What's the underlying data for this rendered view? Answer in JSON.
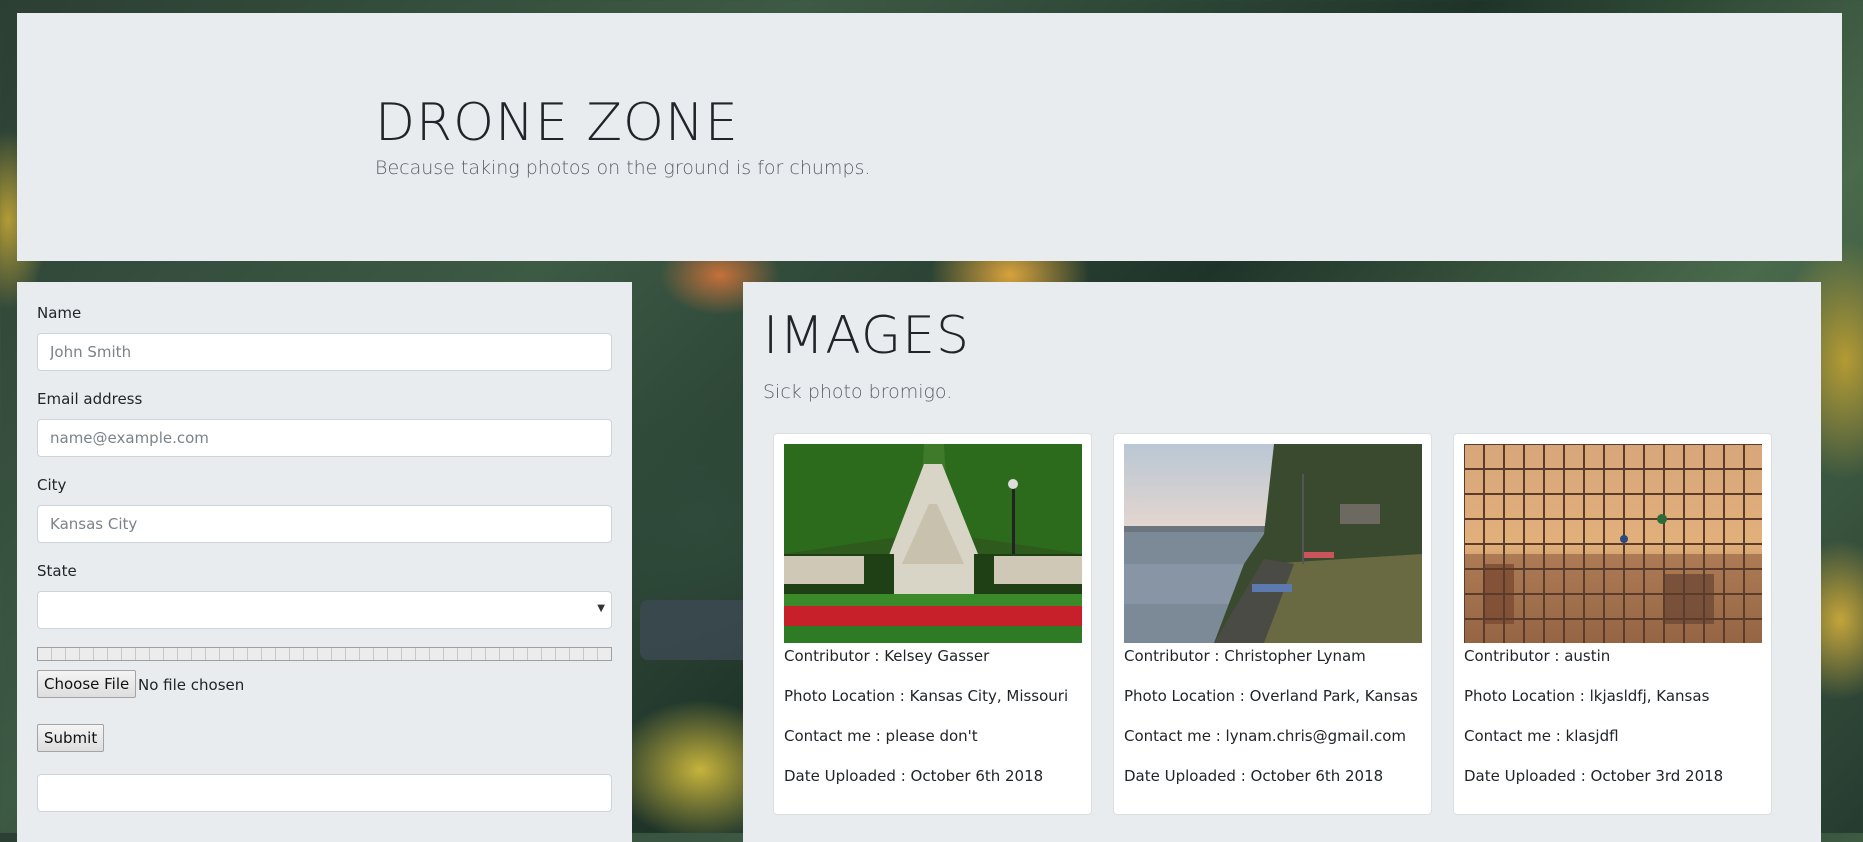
{
  "header": {
    "title": "DRONE ZONE",
    "tagline": "Because taking photos on the ground is for chumps."
  },
  "form": {
    "name_label": "Name",
    "name_placeholder": "John Smith",
    "email_label": "Email address",
    "email_placeholder": "name@example.com",
    "city_label": "City",
    "city_placeholder": "Kansas City",
    "state_label": "State",
    "state_value": "",
    "upload_progress": 0,
    "choose_file_label": "Choose File",
    "no_file_text": "No file chosen",
    "submit_label": "Submit"
  },
  "gallery": {
    "title": "IMAGES",
    "subtitle": "Sick photo bromigo.",
    "cards": [
      {
        "contributor": "Contributor : Kelsey Gasser",
        "location": "Photo Location : Kansas City, Missouri",
        "contact": "Contact me : please don't",
        "date": "Date Uploaded : October 6th 2018"
      },
      {
        "contributor": "Contributor : Christopher Lynam",
        "location": "Photo Location : Overland Park, Kansas",
        "contact": "Contact me : lynam.chris@gmail.com",
        "date": "Date Uploaded : October 6th 2018"
      },
      {
        "contributor": "Contributor : austin",
        "location": "Photo Location : lkjasldfj, Kansas",
        "contact": "Contact me : klasjdfl",
        "date": "Date Uploaded : October 3rd 2018"
      }
    ]
  },
  "colors": {
    "panel_bg": "#e9ecef",
    "text": "#212529",
    "muted": "#5a6269"
  },
  "icons": {
    "select_chevron": "chevron-down-icon"
  }
}
